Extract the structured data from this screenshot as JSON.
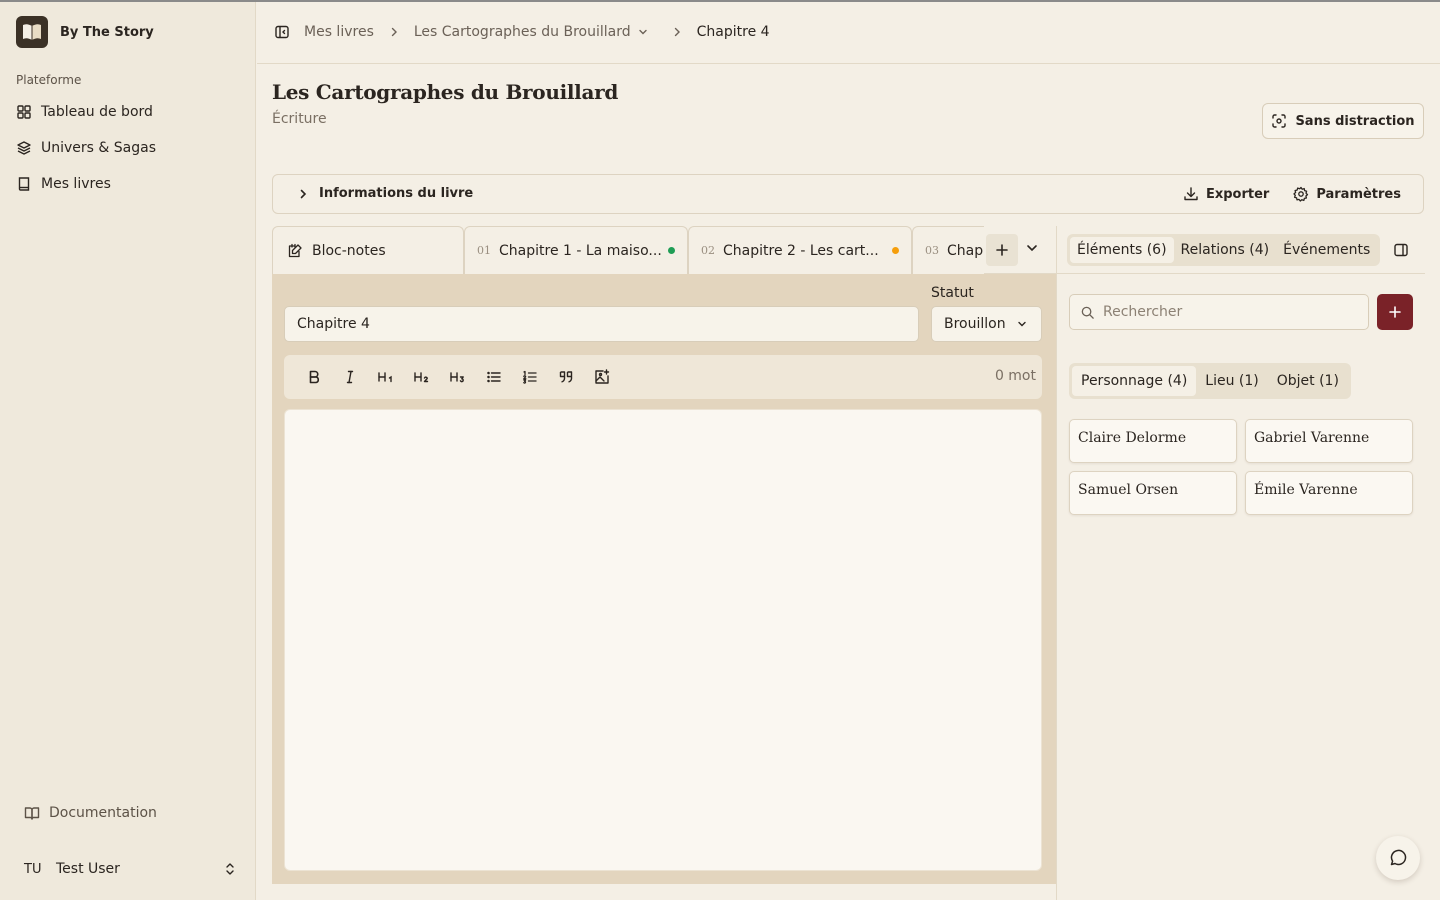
{
  "app": {
    "name": "By The Story"
  },
  "sidebar": {
    "section_label": "Plateforme",
    "items": [
      {
        "label": "Tableau de bord",
        "icon": "grid-icon"
      },
      {
        "label": "Univers & Sagas",
        "icon": "layers-icon"
      },
      {
        "label": "Mes livres",
        "icon": "book-icon"
      }
    ],
    "docs_label": "Documentation",
    "user": {
      "initials": "TU",
      "name": "Test User"
    }
  },
  "breadcrumb": {
    "items": [
      "Mes livres",
      "Les Cartographes du Brouillard",
      "Chapitre 4"
    ]
  },
  "page": {
    "title": "Les Cartographes du Brouillard",
    "subtitle": "Écriture",
    "focus_label": "Sans distraction"
  },
  "book_info": {
    "label": "Informations du livre",
    "export_label": "Exporter",
    "settings_label": "Paramètres"
  },
  "tabs": {
    "notes_label": "Bloc-notes",
    "chapters": [
      {
        "num": "01",
        "label": "Chapitre 1 - La maiso...",
        "dot_color": "#1f9d55"
      },
      {
        "num": "02",
        "label": "Chapitre 2 - Les cart...",
        "dot_color": "#f59e0b"
      },
      {
        "num": "03",
        "label": "Chap",
        "dot_color": ""
      }
    ]
  },
  "editor": {
    "chapter_title": "Chapitre 4",
    "status_label": "Statut",
    "status_value": "Brouillon",
    "word_count": "0 mot",
    "toolbar": [
      "bold-icon",
      "italic-icon",
      "heading1-icon",
      "heading2-icon",
      "heading3-icon",
      "bullet-list-icon",
      "numbered-list-icon",
      "quote-icon",
      "image-icon"
    ]
  },
  "panel": {
    "tabs": [
      "Éléments (6)",
      "Relations (4)",
      "Événements"
    ],
    "active_tab": 0,
    "search_placeholder": "Rechercher",
    "categories": [
      "Personnage (4)",
      "Lieu (1)",
      "Objet (1)"
    ],
    "active_category": 0,
    "elements": [
      "Claire Delorme",
      "Gabriel Varenne",
      "Samuel Orsen",
      "Émile Varenne"
    ]
  },
  "colors": {
    "accent": "#7a2228",
    "background": "#f4efe5",
    "editor_frame": "#e3d5be"
  }
}
